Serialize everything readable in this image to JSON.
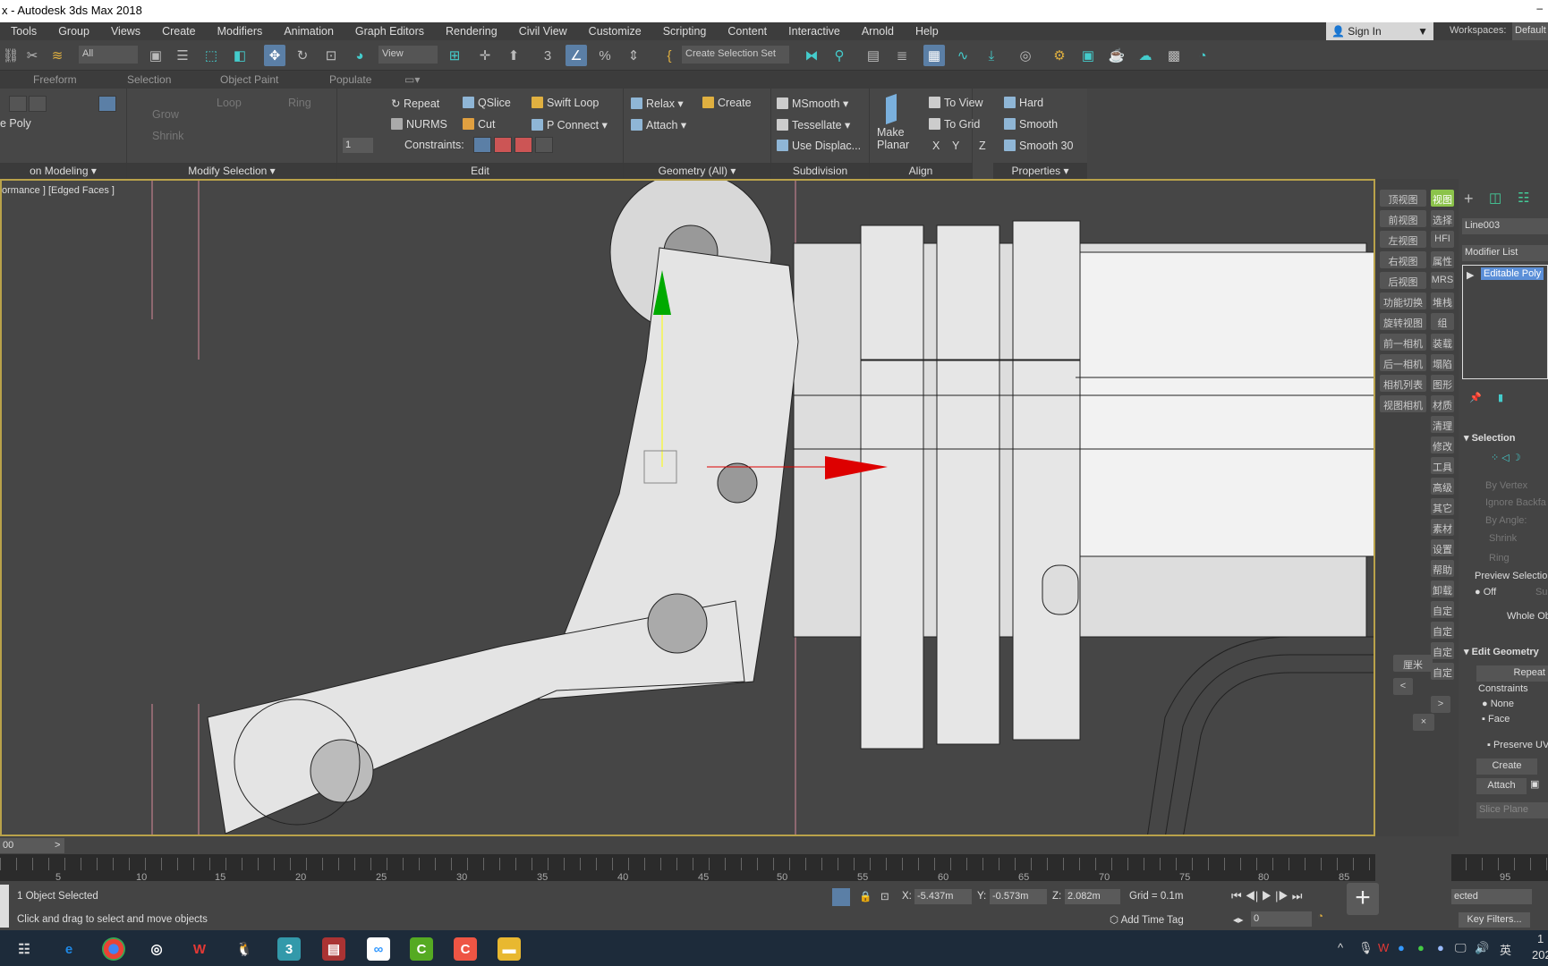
{
  "window": {
    "title": "x - Autodesk 3ds Max 2018",
    "minimize": "–"
  },
  "menu": [
    "Tools",
    "Group",
    "Views",
    "Create",
    "Modifiers",
    "Animation",
    "Graph Editors",
    "Rendering",
    "Civil View",
    "Customize",
    "Scripting",
    "Content",
    "Interactive",
    "Arnold",
    "Help"
  ],
  "account": {
    "sign_in": "Sign In",
    "workspaces_label": "Workspaces:",
    "workspace": "Default"
  },
  "toolbar": {
    "selection_filter": "All",
    "ref_coord": "View",
    "selection_set": "Create Selection Set"
  },
  "ribbon_tabs": [
    "Freeform",
    "Selection",
    "Object Paint",
    "Populate"
  ],
  "ribbon": {
    "poly_label": "e Poly",
    "panel_poly": "on Modeling ▾",
    "grow": "Grow",
    "shrink": "Shrink",
    "loop": "Loop",
    "ring": "Ring",
    "panel_modsel": "Modify Selection ▾",
    "repeat": "Repeat",
    "qslice": "QSlice",
    "swift_loop": "Swift Loop",
    "nurms": "NURMS",
    "cut": "Cut",
    "p_connect": "P Connect ▾",
    "constraints": "Constraints:",
    "spinner": "1",
    "panel_edit": "Edit",
    "relax": "Relax ▾",
    "create": "Create",
    "attach": "Attach ▾",
    "panel_geom": "Geometry (All) ▾",
    "msmooth": "MSmooth ▾",
    "tessellate": "Tessellate ▾",
    "use_displace": "Use Displac...",
    "panel_subdiv": "Subdivision",
    "make_planar_1": "Make",
    "make_planar_2": "Planar",
    "to_view": "To View",
    "to_grid": "To Grid",
    "x": "X",
    "y": "Y",
    "z": "Z",
    "panel_align": "Align",
    "hard": "Hard",
    "smooth": "Smooth",
    "smooth30": "Smooth 30",
    "panel_props": "Properties ▾"
  },
  "viewport": {
    "label": "ormance ] [Edged Faces ]"
  },
  "cmd_left": [
    "顶视图",
    "前视图",
    "左视图",
    "右视图",
    "后视图",
    "功能切换",
    "旋转视图",
    "前一相机",
    "后一相机",
    "相机列表",
    "视图相机"
  ],
  "cmd_right": [
    "视图",
    "选择",
    "HFI",
    "属性",
    "MRS",
    "堆栈",
    "组",
    "装载",
    "塌陷",
    "图形",
    "材质",
    "清理",
    "修改",
    "工具",
    "高级",
    "其它",
    "素材",
    "设置",
    "帮助",
    "卸载",
    "自定",
    "自定",
    "自定",
    "自定"
  ],
  "cmd_extra": {
    "unit": "厘米",
    "back": "<",
    "next": ">",
    "close": "×"
  },
  "cmd_panel": {
    "object_name": "Line003",
    "modifier_list": "Modifier List",
    "stack_item": "Editable Poly",
    "selection": "Selection",
    "by_vertex": "By Vertex",
    "ignore_backfacing": "Ignore Backfa",
    "by_angle": "By Angle:",
    "shrink": "Shrink",
    "ring": "Ring",
    "preview_selection": "Preview Selection",
    "off": "Off",
    "sub": "Sub",
    "whole_object": "Whole Ob",
    "edit_geometry": "Edit Geometry",
    "repeat": "Repeat",
    "constraints": "Constraints",
    "none": "None",
    "face": "Face",
    "preserve_uv": "Preserve UV",
    "create": "Create",
    "attach": "Attach",
    "slice_plane": "Slice Plane"
  },
  "timeline": {
    "frame": "00",
    "next": ">",
    "ticks": [
      "5",
      "10",
      "15",
      "20",
      "25",
      "30",
      "35",
      "40",
      "45",
      "50",
      "55",
      "60",
      "65",
      "70",
      "75",
      "80",
      "85",
      "95"
    ]
  },
  "status": {
    "selected": "1 Object Selected",
    "prompt": "Click and drag to select and move objects",
    "x_label": "X:",
    "x": "-5.437m",
    "y_label": "Y:",
    "y": "-0.573m",
    "z_label": "Z:",
    "z": "2.082m",
    "grid": "Grid = 0.1m",
    "add_time_tag": "Add Time Tag",
    "frame": "0",
    "selected_dd": "ected",
    "key_filters": "Key Filters..."
  },
  "taskbar": {
    "ime": "英",
    "clock_1": "1",
    "clock_2": "202"
  }
}
